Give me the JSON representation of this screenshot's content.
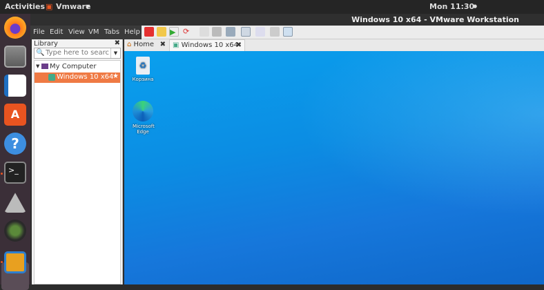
{
  "topbar": {
    "activities": "Activities",
    "app_menu": "Vmware",
    "clock": "Mon 11:30"
  },
  "window": {
    "title": "Windows 10 x64 - VMware Workstation"
  },
  "menu": [
    "File",
    "Edit",
    "View",
    "VM",
    "Tabs",
    "Help"
  ],
  "library": {
    "title": "Library",
    "search_placeholder": "Type here to search",
    "tree": {
      "root": "My Computer",
      "vm": "Windows 10 x64"
    }
  },
  "tabs": [
    {
      "label": "Home"
    },
    {
      "label": "Windows 10 x64"
    }
  ],
  "desktop": {
    "icons": [
      {
        "label": "Корзина"
      },
      {
        "label": "Microsoft Edge"
      }
    ]
  },
  "colors": {
    "accent": "#e95420",
    "desktop": "#0b8de3"
  }
}
